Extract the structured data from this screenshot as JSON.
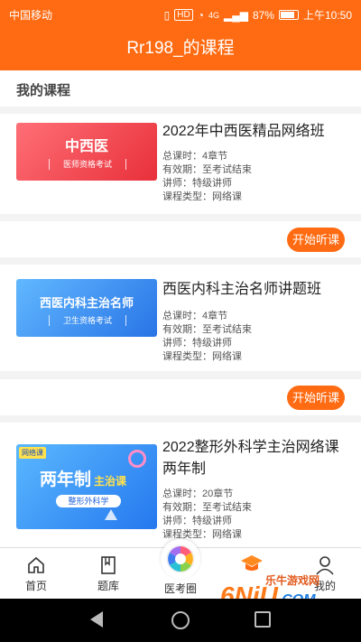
{
  "status": {
    "carrier": "中国移动",
    "network1": "HD",
    "network2": "4G",
    "battery": "87%",
    "time": "上午10:50"
  },
  "header": {
    "title": "Rr198_的课程"
  },
  "section": {
    "title": "我的课程"
  },
  "courses": [
    {
      "thumb_main": "中西医",
      "thumb_sub": "医师资格考试",
      "title": "2022年中西医精品网络班",
      "hours": "总课时：4章节",
      "validity": "有效期：至考试结束",
      "teacher": "讲师：特级讲师",
      "type": "课程类型：网络课"
    },
    {
      "thumb_main": "西医内科主治名师",
      "thumb_sub": "卫生资格考试",
      "title": "西医内科主治名师讲题班",
      "hours": "总课时：4章节",
      "validity": "有效期：至考试结束",
      "teacher": "讲师：特级讲师",
      "type": "课程类型：网络课"
    },
    {
      "thumb_badge": "网络课",
      "thumb_main": "两年制",
      "thumb_main2": "主治课",
      "thumb_sub": "整形外科学",
      "title": "2022整形外科学主治网络课两年制",
      "hours": "总课时：20章节",
      "validity": "有效期：至考试结束",
      "teacher": "讲师：特级讲师",
      "type": "课程类型：网络课"
    }
  ],
  "actions": {
    "start": "开始听课"
  },
  "tabs": [
    {
      "label": "首页"
    },
    {
      "label": "题库"
    },
    {
      "label": "医考圈"
    },
    {
      "label": "我的"
    }
  ],
  "watermark": {
    "brand": "6NiU",
    "suffix": ".COM",
    "chinese": "乐牛游戏网"
  },
  "colors": {
    "accent": "#ff6b12",
    "bg": "#f3f3f3"
  }
}
